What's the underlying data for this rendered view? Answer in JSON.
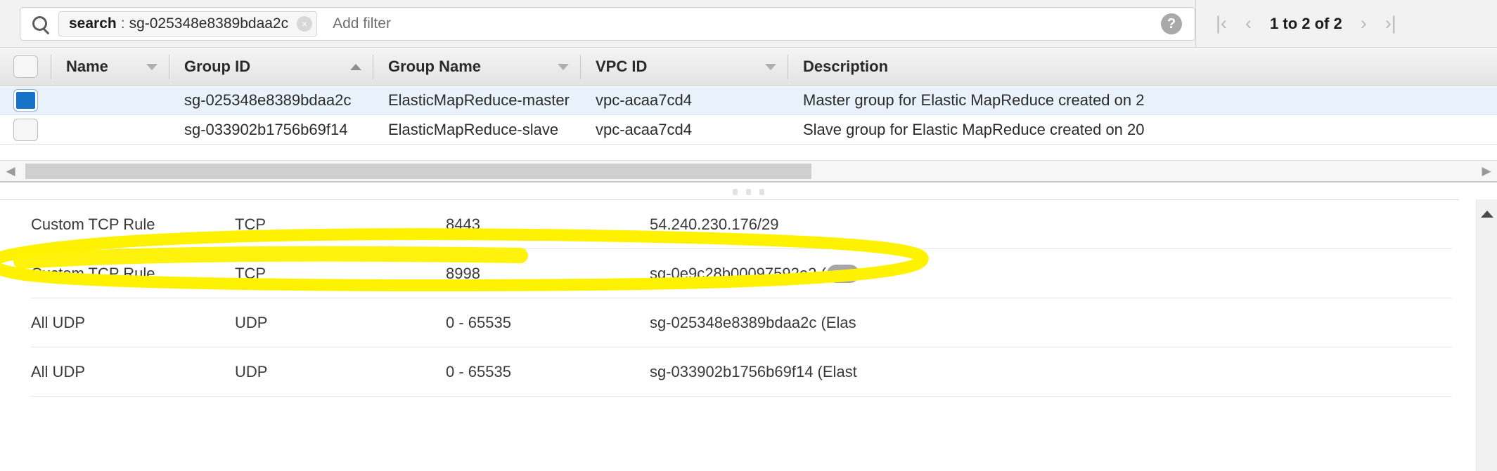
{
  "search": {
    "icon": "search-icon",
    "token_key": "search",
    "token_separator": ":",
    "token_value": "sg-025348e8389bdaa2c",
    "token_clear_icon": "×",
    "add_filter_label": "Add filter",
    "help_icon": "?"
  },
  "pagination": {
    "first_icon": "|‹",
    "prev_icon": "‹",
    "label": "1 to 2 of 2",
    "next_icon": "›",
    "last_icon": "›|"
  },
  "table": {
    "columns": [
      {
        "label": "",
        "sort": "none",
        "name": "select-all"
      },
      {
        "label": "Name",
        "sort": "desc"
      },
      {
        "label": "Group ID",
        "sort": "asc"
      },
      {
        "label": "Group Name",
        "sort": "desc"
      },
      {
        "label": "VPC ID",
        "sort": "desc"
      },
      {
        "label": "Description",
        "sort": "none"
      }
    ],
    "rows": [
      {
        "selected": true,
        "name": "",
        "group_id": "sg-025348e8389bdaa2c",
        "group_name": "ElasticMapReduce-master",
        "vpc_id": "vpc-acaa7cd4",
        "description": "Master group for Elastic MapReduce created on 2"
      },
      {
        "selected": false,
        "name": "",
        "group_id": "sg-033902b1756b69f14",
        "group_name": "ElasticMapReduce-slave",
        "vpc_id": "vpc-acaa7cd4",
        "description": "Slave group for Elastic MapReduce created on 20"
      }
    ]
  },
  "hscrollbar": {
    "left_arrow": "◀",
    "right_arrow": "▶"
  },
  "detail": {
    "rules": [
      {
        "type": "Custom TCP Rule",
        "protocol": "TCP",
        "port_range": "8443",
        "source": "54.240.230.176/29",
        "redacted": false,
        "highlighted": false
      },
      {
        "type": "Custom TCP Rule",
        "protocol": "TCP",
        "port_range": "8998",
        "source": "sg-0e9c28b00097592e2 (",
        "redacted": true,
        "highlighted": true
      },
      {
        "type": "All UDP",
        "protocol": "UDP",
        "port_range": "0 - 65535",
        "source": "sg-025348e8389bdaa2c (Elas",
        "redacted": false,
        "highlighted": false
      },
      {
        "type": "All UDP",
        "protocol": "UDP",
        "port_range": "0 - 65535",
        "source": "sg-033902b1756b69f14 (Elast",
        "redacted": false,
        "highlighted": false
      }
    ]
  },
  "annotation": {
    "kind": "highlighter-ellipse",
    "color": "#FFF200",
    "target_rule_index": 1
  },
  "colors": {
    "selected_row": "#e9f1fb",
    "checkbox_checked": "#1673c8",
    "highlighter": "#FFF200",
    "redaction": "#a6a6a6"
  }
}
